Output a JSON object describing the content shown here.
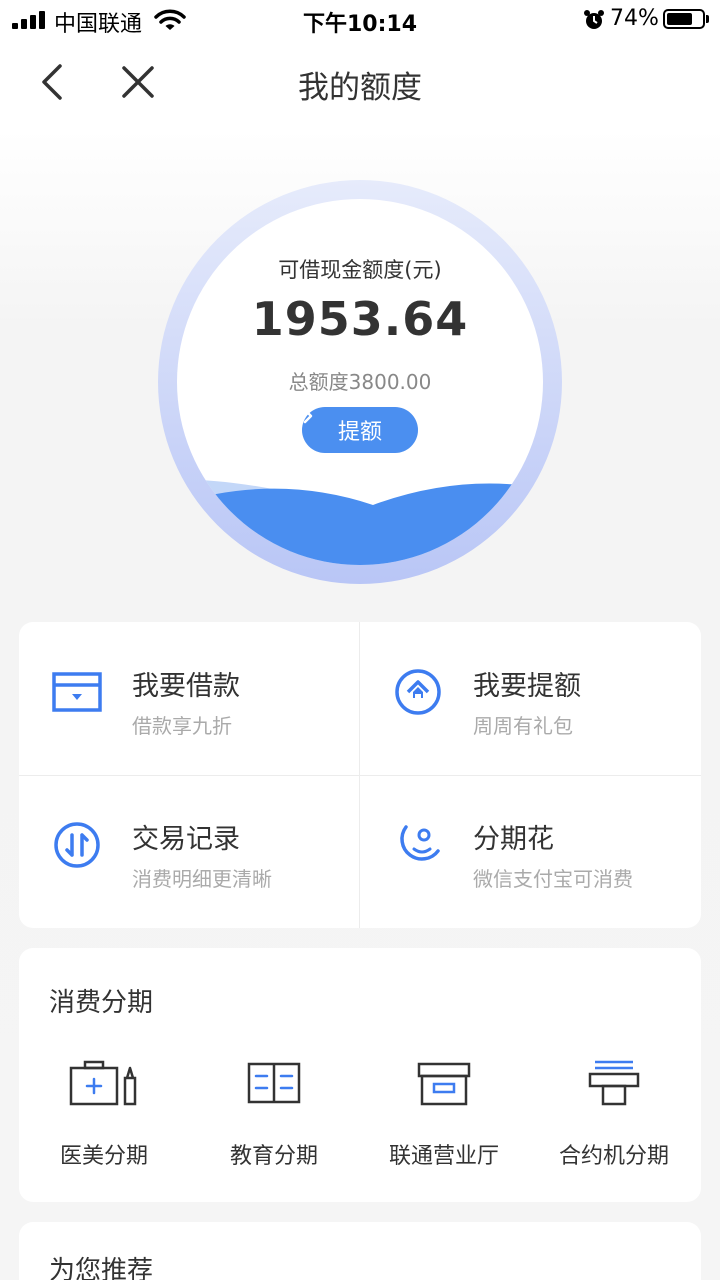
{
  "status_bar": {
    "carrier": "中国联通",
    "time": "下午10:14",
    "battery_percent": "74%",
    "battery_level": 0.74
  },
  "nav": {
    "title": "我的额度",
    "back_icon": "chevron-left-icon",
    "close_icon": "close-icon"
  },
  "quota": {
    "label": "可借现金额度(元)",
    "amount": "1953.64",
    "total": "总额度3800.00",
    "raise_button": "提额",
    "accent": "#4b8ff0"
  },
  "grid": [
    {
      "title": "我要借款",
      "subtitle": "借款享九折",
      "icon": "card-icon"
    },
    {
      "title": "我要提额",
      "subtitle": "周周有礼包",
      "icon": "arrow-up-circle-icon"
    },
    {
      "title": "交易记录",
      "subtitle": "消费明细更清晰",
      "icon": "transfer-icon"
    },
    {
      "title": "分期花",
      "subtitle": "微信支付宝可消费",
      "icon": "moon-icon"
    }
  ],
  "installment": {
    "title": "消费分期",
    "items": [
      {
        "label": "医美分期",
        "icon": "medical-kit-icon"
      },
      {
        "label": "教育分期",
        "icon": "book-icon"
      },
      {
        "label": "联通营业厅",
        "icon": "store-icon"
      },
      {
        "label": "合约机分期",
        "icon": "phone-contract-icon"
      }
    ]
  },
  "recommend": {
    "title": "为您推荐"
  }
}
